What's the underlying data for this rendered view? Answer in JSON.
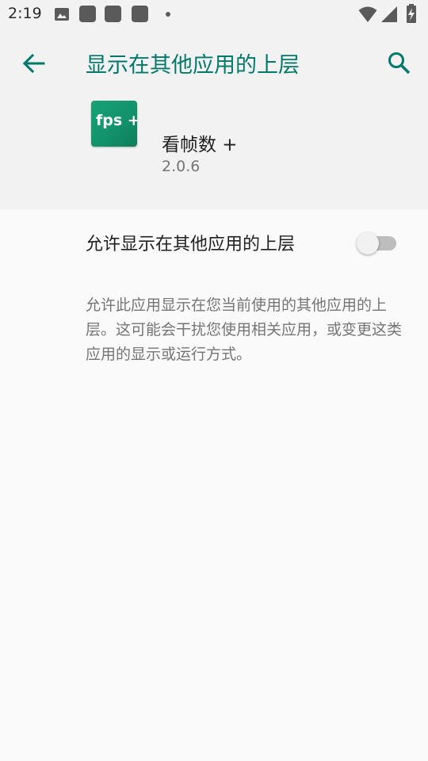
{
  "status_bar": {
    "time": "2:19"
  },
  "header": {
    "title": "显示在其他应用的上层"
  },
  "app": {
    "name": "看帧数 +",
    "version": "2.0.6",
    "icon_text": "fps +"
  },
  "permission": {
    "label": "允许显示在其他应用的上层",
    "enabled": false,
    "description": "允许此应用显示在您当前使用的其他应用的上层。这可能会干扰您使用相关应用，或变更这类应用的显示或运行方式。"
  },
  "colors": {
    "accent": "#00796b",
    "header_bg": "#f2f2f2",
    "page_bg": "#fafafa"
  },
  "icons": [
    "image-icon",
    "app-notification-icon",
    "wifi-icon",
    "signal-icon",
    "battery-charging-icon",
    "back-arrow-icon",
    "search-icon"
  ]
}
